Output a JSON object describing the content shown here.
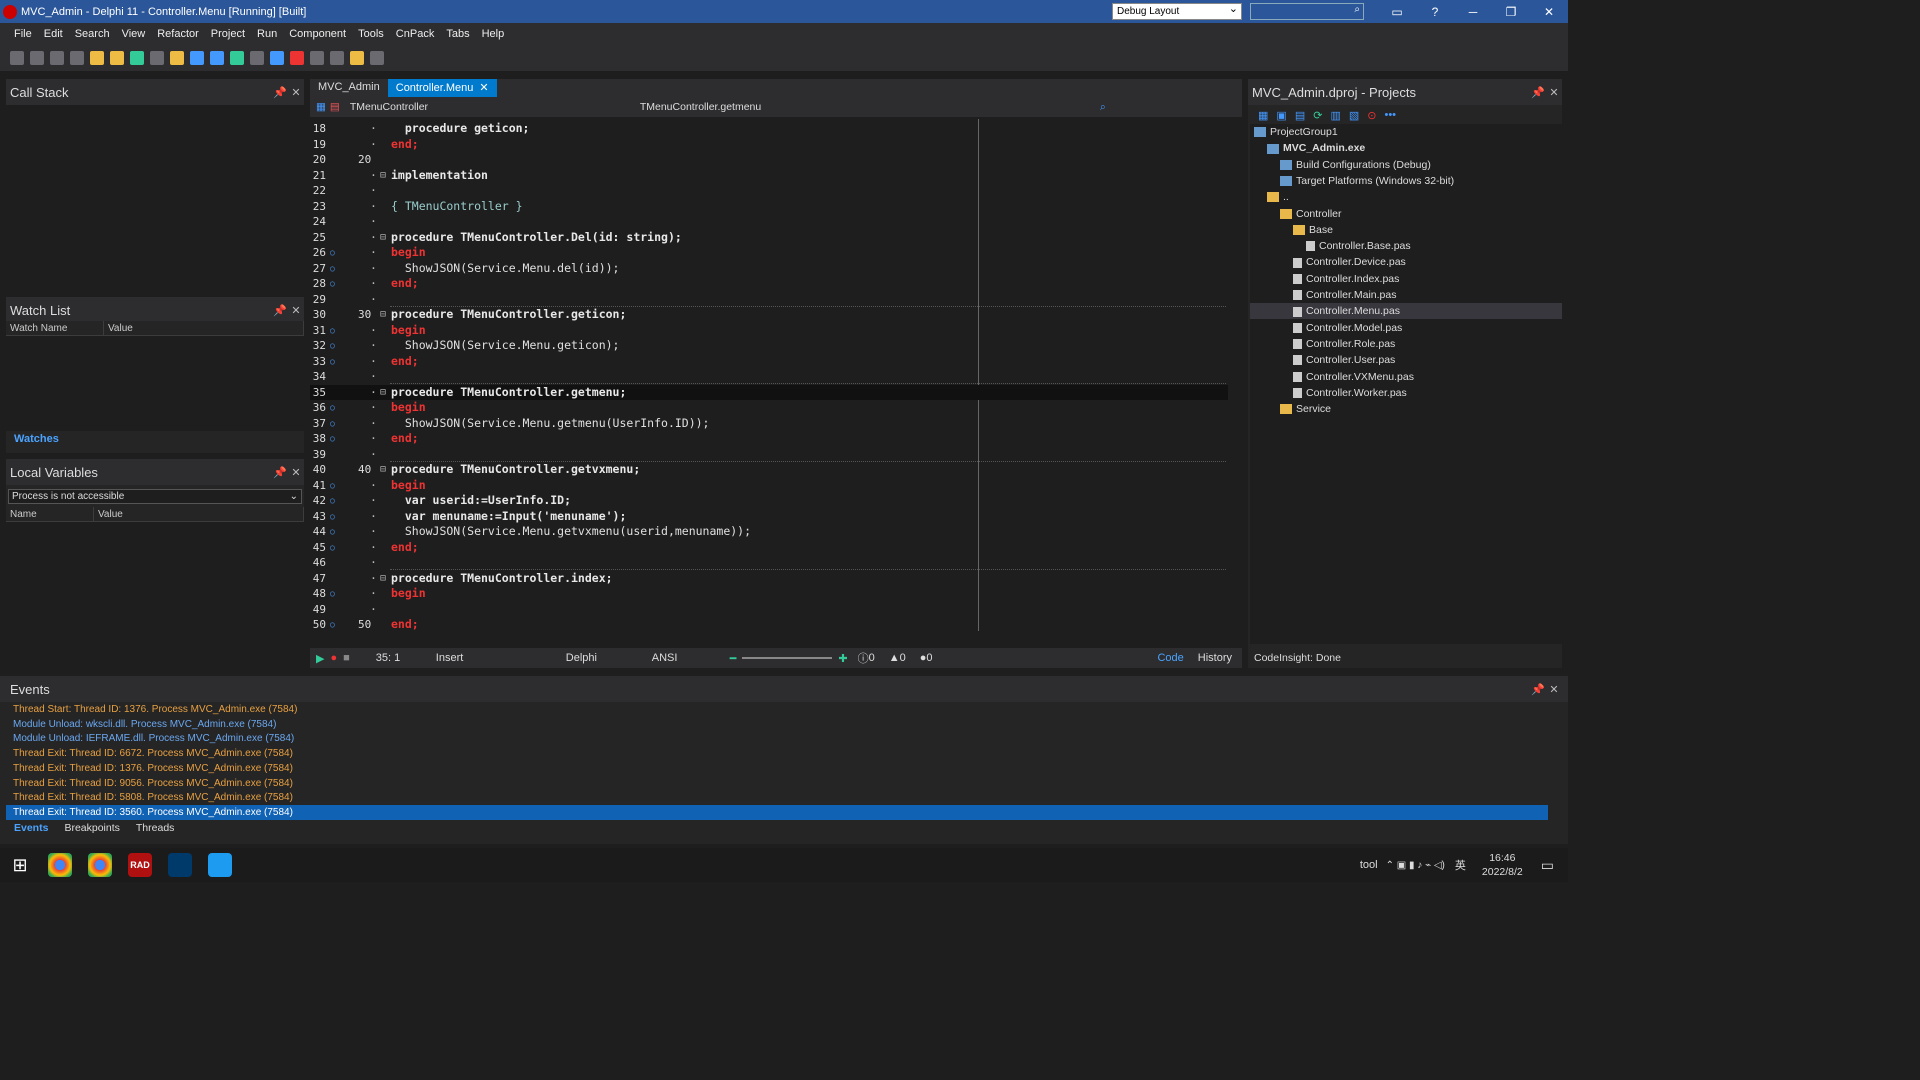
{
  "window": {
    "title": "MVC_Admin - Delphi 11 - Controller.Menu [Running] [Built]",
    "layout": "Debug Layout",
    "buttons": {
      "minimize": "─",
      "restore": "❐",
      "close": "✕",
      "help": "?"
    }
  },
  "menu": [
    "File",
    "Edit",
    "Search",
    "View",
    "Refactor",
    "Project",
    "Run",
    "Component",
    "Tools",
    "CnPack",
    "Tabs",
    "Help"
  ],
  "call_stack": {
    "title": "Call Stack"
  },
  "watch_list": {
    "title": "Watch List",
    "col_name": "Watch Name",
    "col_value": "Value",
    "tab": "Watches"
  },
  "local_vars": {
    "title": "Local Variables",
    "combo": "Process is not accessible",
    "col_name": "Name",
    "col_value": "Value"
  },
  "editor": {
    "tabs": [
      "MVC_Admin",
      "Controller.Menu"
    ],
    "class_nav": "TMenuController",
    "method_nav": "TMenuController.getmenu",
    "lines": [
      {
        "n": "18",
        "t": "  procedure geticon;"
      },
      {
        "n": "19",
        "t": "end;"
      },
      {
        "n": "20",
        "t": ""
      },
      {
        "n": "21",
        "t": "implementation"
      },
      {
        "n": "22",
        "t": ""
      },
      {
        "n": "23",
        "t": "{ TMenuController }"
      },
      {
        "n": "24",
        "t": ""
      },
      {
        "n": "25",
        "t": "procedure TMenuController.Del(id: string);"
      },
      {
        "n": "26",
        "t": "begin"
      },
      {
        "n": "27",
        "t": "  ShowJSON(Service.Menu.del(id));"
      },
      {
        "n": "28",
        "t": "end;"
      },
      {
        "n": "29",
        "t": ""
      },
      {
        "n": "30",
        "t": "procedure TMenuController.geticon;"
      },
      {
        "n": "31",
        "t": "begin"
      },
      {
        "n": "32",
        "t": "  ShowJSON(Service.Menu.geticon);"
      },
      {
        "n": "33",
        "t": "end;"
      },
      {
        "n": "34",
        "t": ""
      },
      {
        "n": "35",
        "t": "procedure TMenuController.getmenu;"
      },
      {
        "n": "36",
        "t": "begin"
      },
      {
        "n": "37",
        "t": "  ShowJSON(Service.Menu.getmenu(UserInfo.ID));"
      },
      {
        "n": "38",
        "t": "end;"
      },
      {
        "n": "39",
        "t": ""
      },
      {
        "n": "40",
        "t": "procedure TMenuController.getvxmenu;"
      },
      {
        "n": "41",
        "t": "begin"
      },
      {
        "n": "42",
        "t": "  var userid:=UserInfo.ID;"
      },
      {
        "n": "43",
        "t": "  var menuname:=Input('menuname');"
      },
      {
        "n": "44",
        "t": "  ShowJSON(Service.Menu.getvxmenu(userid,menuname));"
      },
      {
        "n": "45",
        "t": "end;"
      },
      {
        "n": "46",
        "t": ""
      },
      {
        "n": "47",
        "t": "procedure TMenuController.index;"
      },
      {
        "n": "48",
        "t": "begin"
      },
      {
        "n": "49",
        "t": ""
      },
      {
        "n": "50",
        "t": "end;"
      }
    ],
    "status": {
      "pos": "35: 1",
      "mode": "Insert",
      "lang": "Delphi",
      "enc": "ANSI",
      "hints": "0",
      "warnings": "0",
      "errors": "0",
      "code_tab": "Code",
      "history_tab": "History"
    }
  },
  "projects": {
    "title": "MVC_Admin.dproj - Projects",
    "items": [
      {
        "label": "ProjectGroup1",
        "type": "group"
      },
      {
        "label": "MVC_Admin.exe",
        "type": "exe"
      },
      {
        "label": "Build Configurations (Debug)",
        "type": "cfg"
      },
      {
        "label": "Target Platforms (Windows 32-bit)",
        "type": "cfg"
      },
      {
        "label": "..",
        "type": "folder"
      },
      {
        "label": "Controller",
        "type": "folder"
      },
      {
        "label": "Base",
        "type": "folder"
      },
      {
        "label": "Controller.Base.pas",
        "type": "file"
      },
      {
        "label": "Controller.Device.pas",
        "type": "file"
      },
      {
        "label": "Controller.Index.pas",
        "type": "file"
      },
      {
        "label": "Controller.Main.pas",
        "type": "file"
      },
      {
        "label": "Controller.Menu.pas",
        "type": "file"
      },
      {
        "label": "Controller.Model.pas",
        "type": "file"
      },
      {
        "label": "Controller.Role.pas",
        "type": "file"
      },
      {
        "label": "Controller.User.pas",
        "type": "file"
      },
      {
        "label": "Controller.VXMenu.pas",
        "type": "file"
      },
      {
        "label": "Controller.Worker.pas",
        "type": "file"
      },
      {
        "label": "Service",
        "type": "folder"
      }
    ],
    "status": "CodeInsight: Done"
  },
  "events": {
    "title": "Events",
    "lines": [
      "Thread Start: Thread ID: 1376. Process MVC_Admin.exe (7584)",
      "Module Unload: wkscli.dll. Process MVC_Admin.exe (7584)",
      "Module Unload: IEFRAME.dll. Process MVC_Admin.exe (7584)",
      "Thread Exit: Thread ID: 6672. Process MVC_Admin.exe (7584)",
      "Thread Exit: Thread ID: 1376. Process MVC_Admin.exe (7584)",
      "Thread Exit: Thread ID: 9056. Process MVC_Admin.exe (7584)",
      "Thread Exit: Thread ID: 5808. Process MVC_Admin.exe (7584)",
      "Thread Exit: Thread ID: 3560. Process MVC_Admin.exe (7584)"
    ],
    "colors": [
      "#e8a040",
      "#6aa8f0",
      "#6aa8f0",
      "#e8a040",
      "#e8a040",
      "#e8a040",
      "#e8a040",
      "#ffffff"
    ],
    "tabs": [
      "Events",
      "Breakpoints",
      "Threads"
    ]
  },
  "taskbar": {
    "tray_label": "tool",
    "time": "16:46",
    "date": "2022/8/2",
    "ime": "英"
  }
}
